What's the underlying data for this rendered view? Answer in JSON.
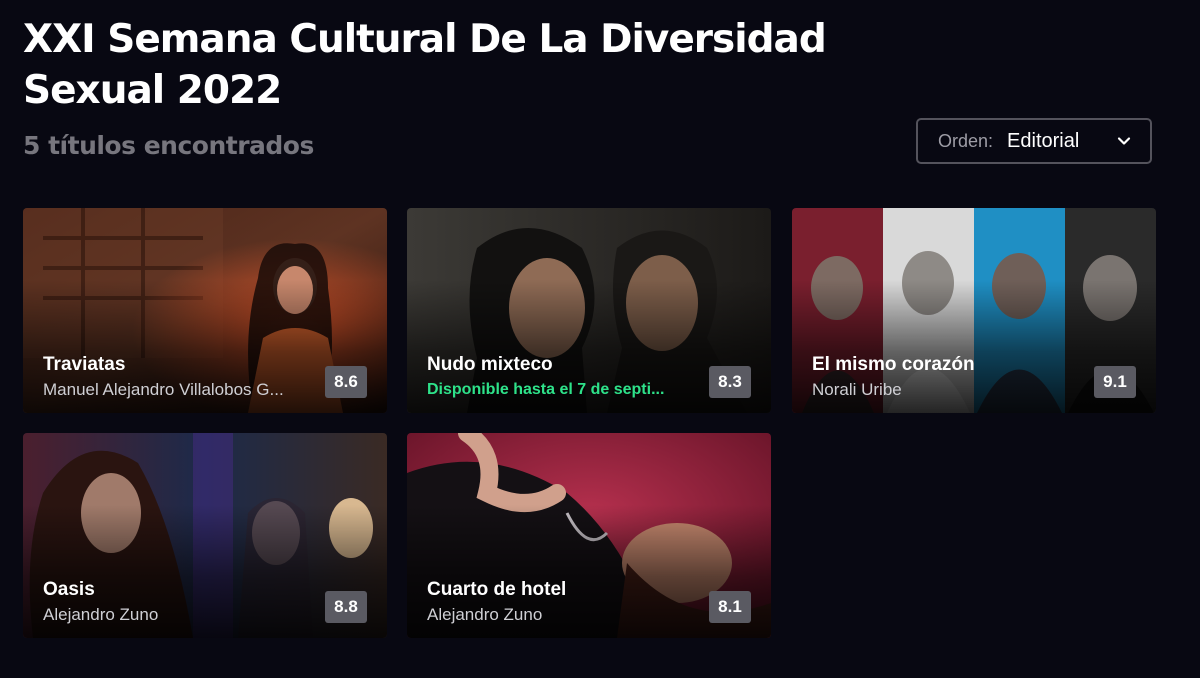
{
  "header": {
    "title": "XXI Semana Cultural De La Diversidad Sexual 2022",
    "results": "5 títulos encontrados"
  },
  "sort": {
    "label": "Orden:",
    "value": "Editorial"
  },
  "colors": {
    "background": "#080812",
    "muted_text": "#77767e",
    "available_green": "#2ee28a",
    "rating_badge": "#5a5a62"
  },
  "films": [
    {
      "title": "Traviatas",
      "subtitle": "Manuel Alejandro Villalobos G...",
      "rating": "8.6"
    },
    {
      "title": "Nudo mixteco",
      "subtitle": "Disponible hasta el 7 de septi...",
      "rating": "8.3"
    },
    {
      "title": "El mismo corazón",
      "subtitle": "Norali Uribe",
      "rating": "9.1"
    },
    {
      "title": "Oasis",
      "subtitle": "Alejandro Zuno",
      "rating": "8.8"
    },
    {
      "title": "Cuarto de hotel",
      "subtitle": "Alejandro Zuno",
      "rating": "8.1"
    }
  ]
}
